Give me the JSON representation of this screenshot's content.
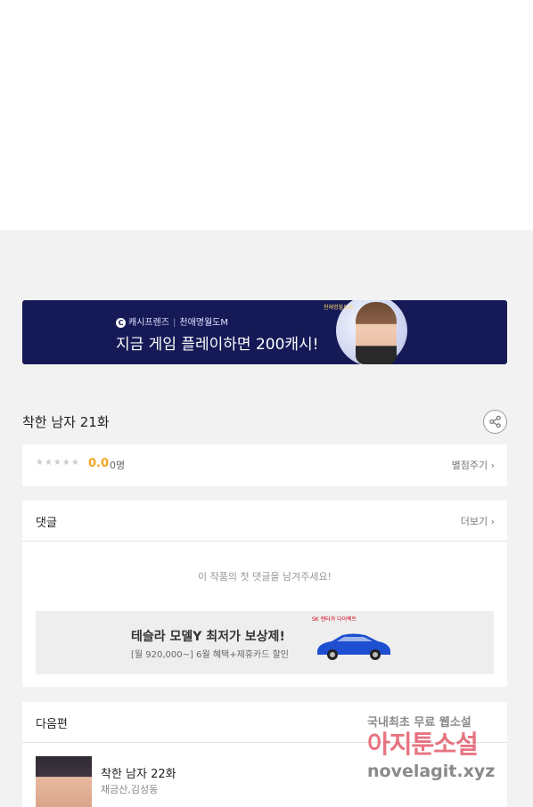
{
  "banner": {
    "brand": "캐시프렌즈",
    "game": "천애명월도M",
    "headline": "지금 게임 플레이하면 200캐시!",
    "game_logo_text": "천애명월도M"
  },
  "episode": {
    "title": "착한 남자 21화"
  },
  "rating": {
    "stars": "★★★★★",
    "score": "0.0",
    "count": "0명",
    "rate_link": "별점주기 ›"
  },
  "comments": {
    "title": "댓글",
    "more": "더보기 ›",
    "empty": "이 작품의 첫 댓글을 남겨주세요!"
  },
  "ad": {
    "brand": "SK 렌터카 다이렉트",
    "title": "테슬라 모델Y 최저가 보상제!",
    "subtitle": "[월 920,000~] 6월 혜택+제휴카드 할인"
  },
  "next": {
    "header": "다음편",
    "title": "착한 남자 22화",
    "authors": "채금산,김성동"
  },
  "watermark": {
    "line1": "국내최초 무료 웹소설",
    "line2": "아지툰소설",
    "line3": "novelagit.xyz"
  }
}
